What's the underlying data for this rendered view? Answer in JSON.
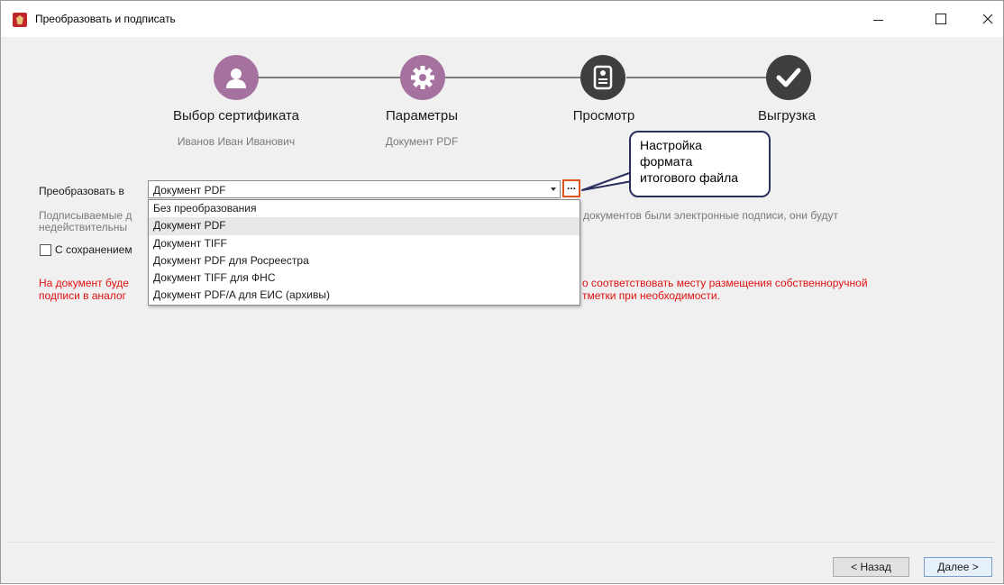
{
  "window": {
    "title": "Преобразовать и подписать",
    "controls": {
      "minimize": "–",
      "maximize": "☐",
      "close": "✕"
    }
  },
  "stepper": {
    "steps": [
      {
        "title": "Выбор сертификата",
        "subtitle": "Иванов Иван Иванович",
        "icon": "user-icon",
        "state": "active"
      },
      {
        "title": "Параметры",
        "subtitle": "Документ PDF",
        "icon": "gear-icon",
        "state": "active"
      },
      {
        "title": "Просмотр",
        "subtitle": "",
        "icon": "certificate-document-icon",
        "state": "pending"
      },
      {
        "title": "Выгрузка",
        "subtitle": "",
        "icon": "checkmark-icon",
        "state": "pending"
      }
    ]
  },
  "form": {
    "convert_label": "Преобразовать в",
    "convert_value": "Документ PDF",
    "settings_button": "...",
    "info_line1": "Подписываемые д",
    "info_line1_rest": "документов были электронные подписи, они будут",
    "info_line2": "недействительны",
    "keep_checkbox_label": "С сохранением",
    "keep_checkbox_checked": false,
    "warning_line1_start": "На документ буде",
    "warning_line1_end": "о соответствовать месту размещения собственноручной",
    "warning_line2_start": "подписи в аналог",
    "warning_line2_end": "тметки при необходимости."
  },
  "dropdown": {
    "options": [
      "Без преобразования",
      "Документ PDF",
      "Документ TIFF",
      "Документ PDF для Росреестра",
      "Документ TIFF для ФНС",
      "Документ PDF/A для ЕИС (архивы)"
    ],
    "selected_index": 1
  },
  "callout": {
    "text_line1": "Настройка",
    "text_line2": "формата",
    "text_line3": "итогового файла"
  },
  "footer": {
    "back_label": "< Назад",
    "next_label": "Далее >"
  },
  "colors": {
    "active_step": "#a5719f",
    "pending_step": "#3f3f3f",
    "warning": "#e01010",
    "highlight_border": "#e0551f",
    "callout_border": "#2b2f5e"
  }
}
